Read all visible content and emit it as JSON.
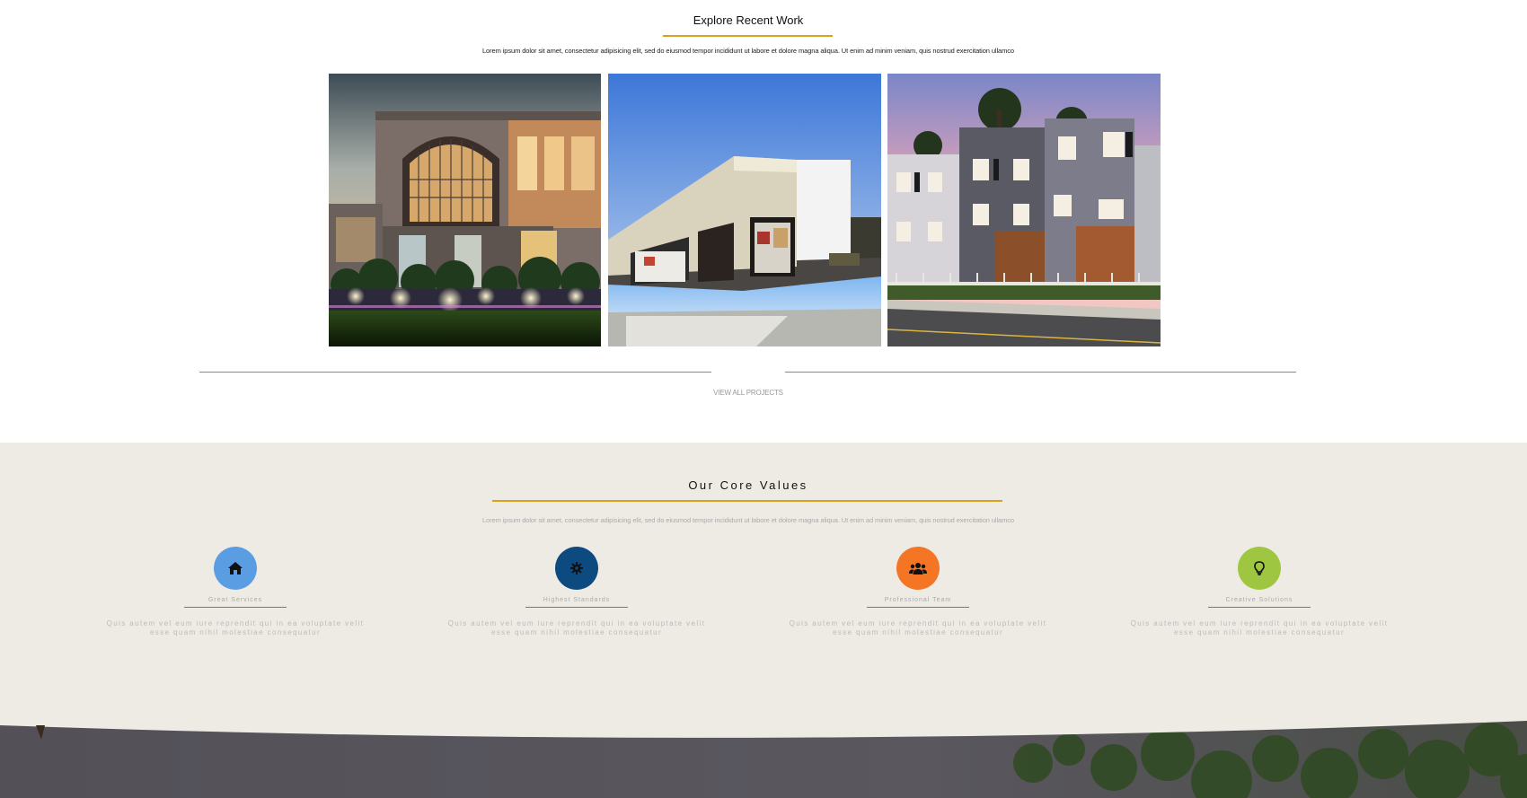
{
  "recent_work": {
    "title": "Explore Recent Work",
    "subtitle": "Lorem ipsum dolor sit amet, consectetur adipisicing elit, sed do eiusmod tempor incididunt ut labore et dolore magna aliqua. Ut enim ad minim veniam, quis nostrud exercitation ullamco",
    "view_all_label": "VIEW ALL PROJECTS",
    "accent": "#d9a21b"
  },
  "core_values": {
    "title": "Our Core Values",
    "subtitle": "Lorem ipsum dolor sit amet, consectetur adipisicing elit, sed do eiusmod tempor incididunt ut labore et dolore magna aliqua. Ut enim ad minim veniam, quis nostrud exercitation ullamco",
    "background": "#eeebe4",
    "items": [
      {
        "icon": "home-icon",
        "color": "#5b9de2",
        "label": "Great Services",
        "text": "Quis autem vel eum iure reprendit qui in ea voluptate velit esse quam nihil molestiae consequatur"
      },
      {
        "icon": "gear-icon",
        "color": "#0d4a80",
        "label": "Highest Standards",
        "text": "Quis autem vel eum iure reprendit qui in ea voluptate velit esse quam nihil molestiae consequatur"
      },
      {
        "icon": "users-icon",
        "color": "#f47523",
        "label": "Professional Team",
        "text": "Quis autem vel eum iure reprendit qui in ea voluptate velit esse quam nihil molestiae consequatur"
      },
      {
        "icon": "lightbulb-icon",
        "color": "#9fc640",
        "label": "Creative Solutions",
        "text": "Quis autem vel eum iure reprendit qui in ea voluptate velit esse quam nihil molestiae consequatur"
      }
    ]
  }
}
